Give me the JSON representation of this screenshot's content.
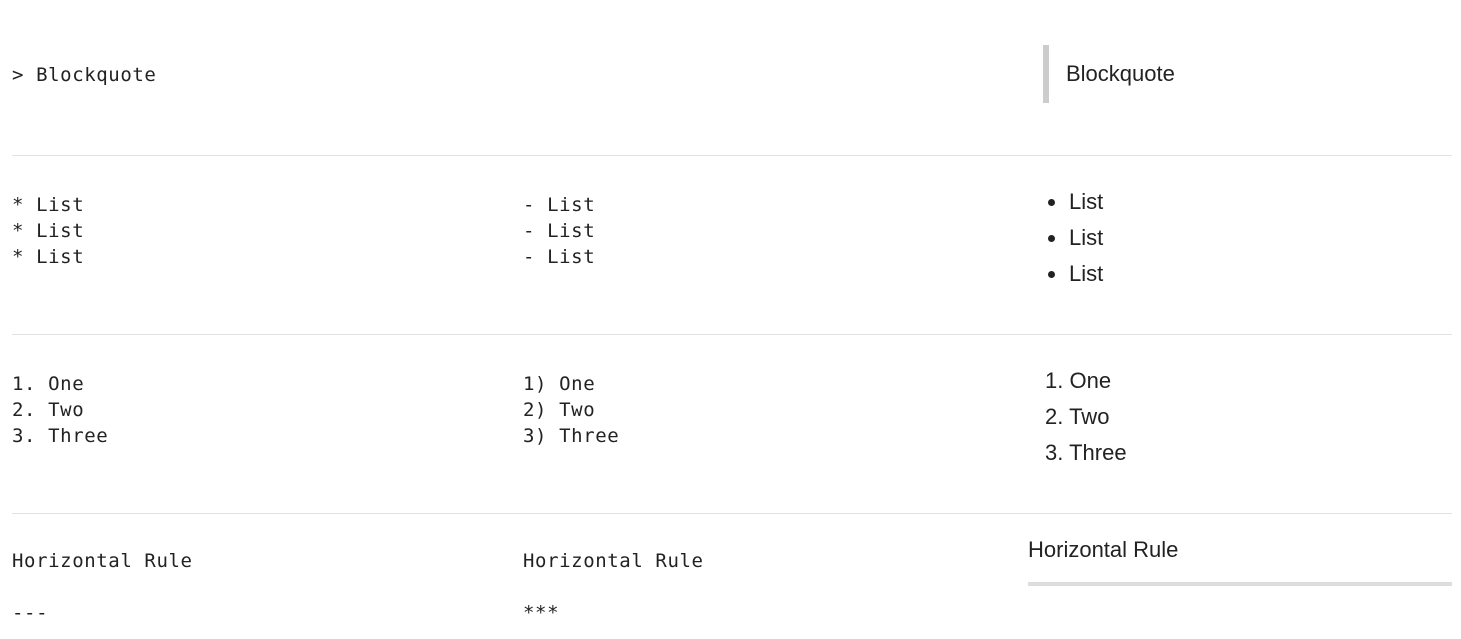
{
  "blockquote": {
    "source": "> Blockquote",
    "rendered": "Blockquote"
  },
  "unordered": {
    "source_star": [
      "* List",
      "* List",
      "* List"
    ],
    "source_dash": [
      "- List",
      "- List",
      "- List"
    ],
    "rendered": [
      "List",
      "List",
      "List"
    ]
  },
  "ordered": {
    "source_dot": [
      "1. One",
      "2. Two",
      "3. Three"
    ],
    "source_paren": [
      "1) One",
      "2) Two",
      "3) Three"
    ],
    "rendered_numbers": [
      "1.",
      "2.",
      "3."
    ],
    "rendered_items": [
      "One",
      "Two",
      "Three"
    ]
  },
  "hrule": {
    "source_dash_label": "Horizontal Rule",
    "source_dash_marker": "---",
    "source_star_label": "Horizontal Rule",
    "source_star_marker": "***",
    "rendered_label": "Horizontal Rule"
  },
  "colors": {
    "text": "#222222",
    "divider": "#e2e2e2",
    "quote_bar": "#cccccc",
    "rule": "#dddddd"
  }
}
